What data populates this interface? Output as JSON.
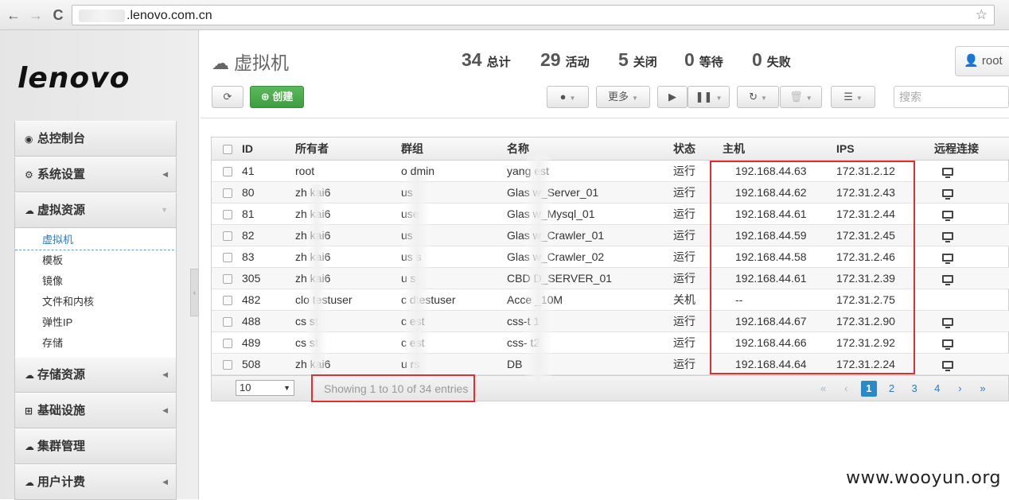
{
  "browser": {
    "url": ".lenovo.com.cn",
    "back_icon": "←",
    "forward_icon": "→",
    "reload_icon": "C"
  },
  "sidebar": {
    "logo": "lenovo",
    "items": [
      {
        "label": "总控制台",
        "icon": "dashboard-icon"
      },
      {
        "label": "系统设置",
        "icon": "gears-icon"
      },
      {
        "label": "虚拟资源",
        "icon": "cloud-icon",
        "open": true,
        "children": [
          "虚拟机",
          "模板",
          "镜像",
          "文件和内核",
          "弹性IP",
          "存储"
        ]
      },
      {
        "label": "存储资源",
        "icon": "cloud-icon"
      },
      {
        "label": "基础设施",
        "icon": "sitemap-icon"
      },
      {
        "label": "集群管理",
        "icon": "cloud-icon"
      },
      {
        "label": "用户计费",
        "icon": "cloud-icon"
      }
    ]
  },
  "header": {
    "title": "虚拟机",
    "stats": [
      {
        "num": "34",
        "label": "总计"
      },
      {
        "num": "29",
        "label": "活动"
      },
      {
        "num": "5",
        "label": "关闭"
      },
      {
        "num": "0",
        "label": "等待"
      },
      {
        "num": "0",
        "label": "失败"
      }
    ],
    "user": "root"
  },
  "toolbar": {
    "create_label": "创建",
    "more_label": "更多",
    "search_placeholder": "搜索"
  },
  "table": {
    "columns": [
      "",
      "ID",
      "所有者",
      "群组",
      "名称",
      "状态",
      "主机",
      "IPS",
      "远程连接"
    ],
    "rows": [
      {
        "id": "41",
        "owner": "root",
        "group": "o  dmin",
        "name": "yang   est",
        "state": "运行",
        "host": "192.168.44.63",
        "ips": "172.31.2.12",
        "remote": true
      },
      {
        "id": "80",
        "owner": "zh   kai6",
        "group": "us",
        "name": "Glas   w_Server_01",
        "state": "运行",
        "host": "192.168.44.62",
        "ips": "172.31.2.43",
        "remote": true
      },
      {
        "id": "81",
        "owner": "zh   kai6",
        "group": "use",
        "name": "Glas   w_Mysql_01",
        "state": "运行",
        "host": "192.168.44.61",
        "ips": "172.31.2.44",
        "remote": true
      },
      {
        "id": "82",
        "owner": "zh   kai6",
        "group": "us",
        "name": "Glas   w_Crawler_01",
        "state": "运行",
        "host": "192.168.44.59",
        "ips": "172.31.2.45",
        "remote": true
      },
      {
        "id": "83",
        "owner": "zh   kai6",
        "group": "us   s",
        "name": "Glas   w_Crawler_02",
        "state": "运行",
        "host": "192.168.44.58",
        "ips": "172.31.2.46",
        "remote": true
      },
      {
        "id": "305",
        "owner": "zh   kai6",
        "group": "u   s",
        "name": "CBD   D_SERVER_01",
        "state": "运行",
        "host": "192.168.44.61",
        "ips": "172.31.2.39",
        "remote": true
      },
      {
        "id": "482",
        "owner": "clo   testuser",
        "group": "c   dtestuser",
        "name": "Acce   _10M",
        "state": "关机",
        "host": "--",
        "ips": "172.31.2.75",
        "remote": false
      },
      {
        "id": "488",
        "owner": "cs   st",
        "group": "c   est",
        "name": "css-t   1",
        "state": "运行",
        "host": "192.168.44.67",
        "ips": "172.31.2.90",
        "remote": true
      },
      {
        "id": "489",
        "owner": "cs   st",
        "group": "c   est",
        "name": "css-   t2",
        "state": "运行",
        "host": "192.168.44.66",
        "ips": "172.31.2.92",
        "remote": true
      },
      {
        "id": "508",
        "owner": "zh   kai6",
        "group": "u   rs",
        "name": "DB",
        "state": "运行",
        "host": "192.168.44.64",
        "ips": "172.31.2.24",
        "remote": true
      }
    ]
  },
  "footer": {
    "page_size": "10",
    "entries_info": "Showing 1 to 10 of 34 entries",
    "pages": [
      "«",
      "‹",
      "1",
      "2",
      "3",
      "4",
      "›",
      "»"
    ],
    "current_page": "1"
  },
  "watermark": "www.wooyun.org",
  "colors": {
    "accent": "#2a7ac8",
    "create": "#47a447",
    "annotation": "#e02f2f"
  }
}
